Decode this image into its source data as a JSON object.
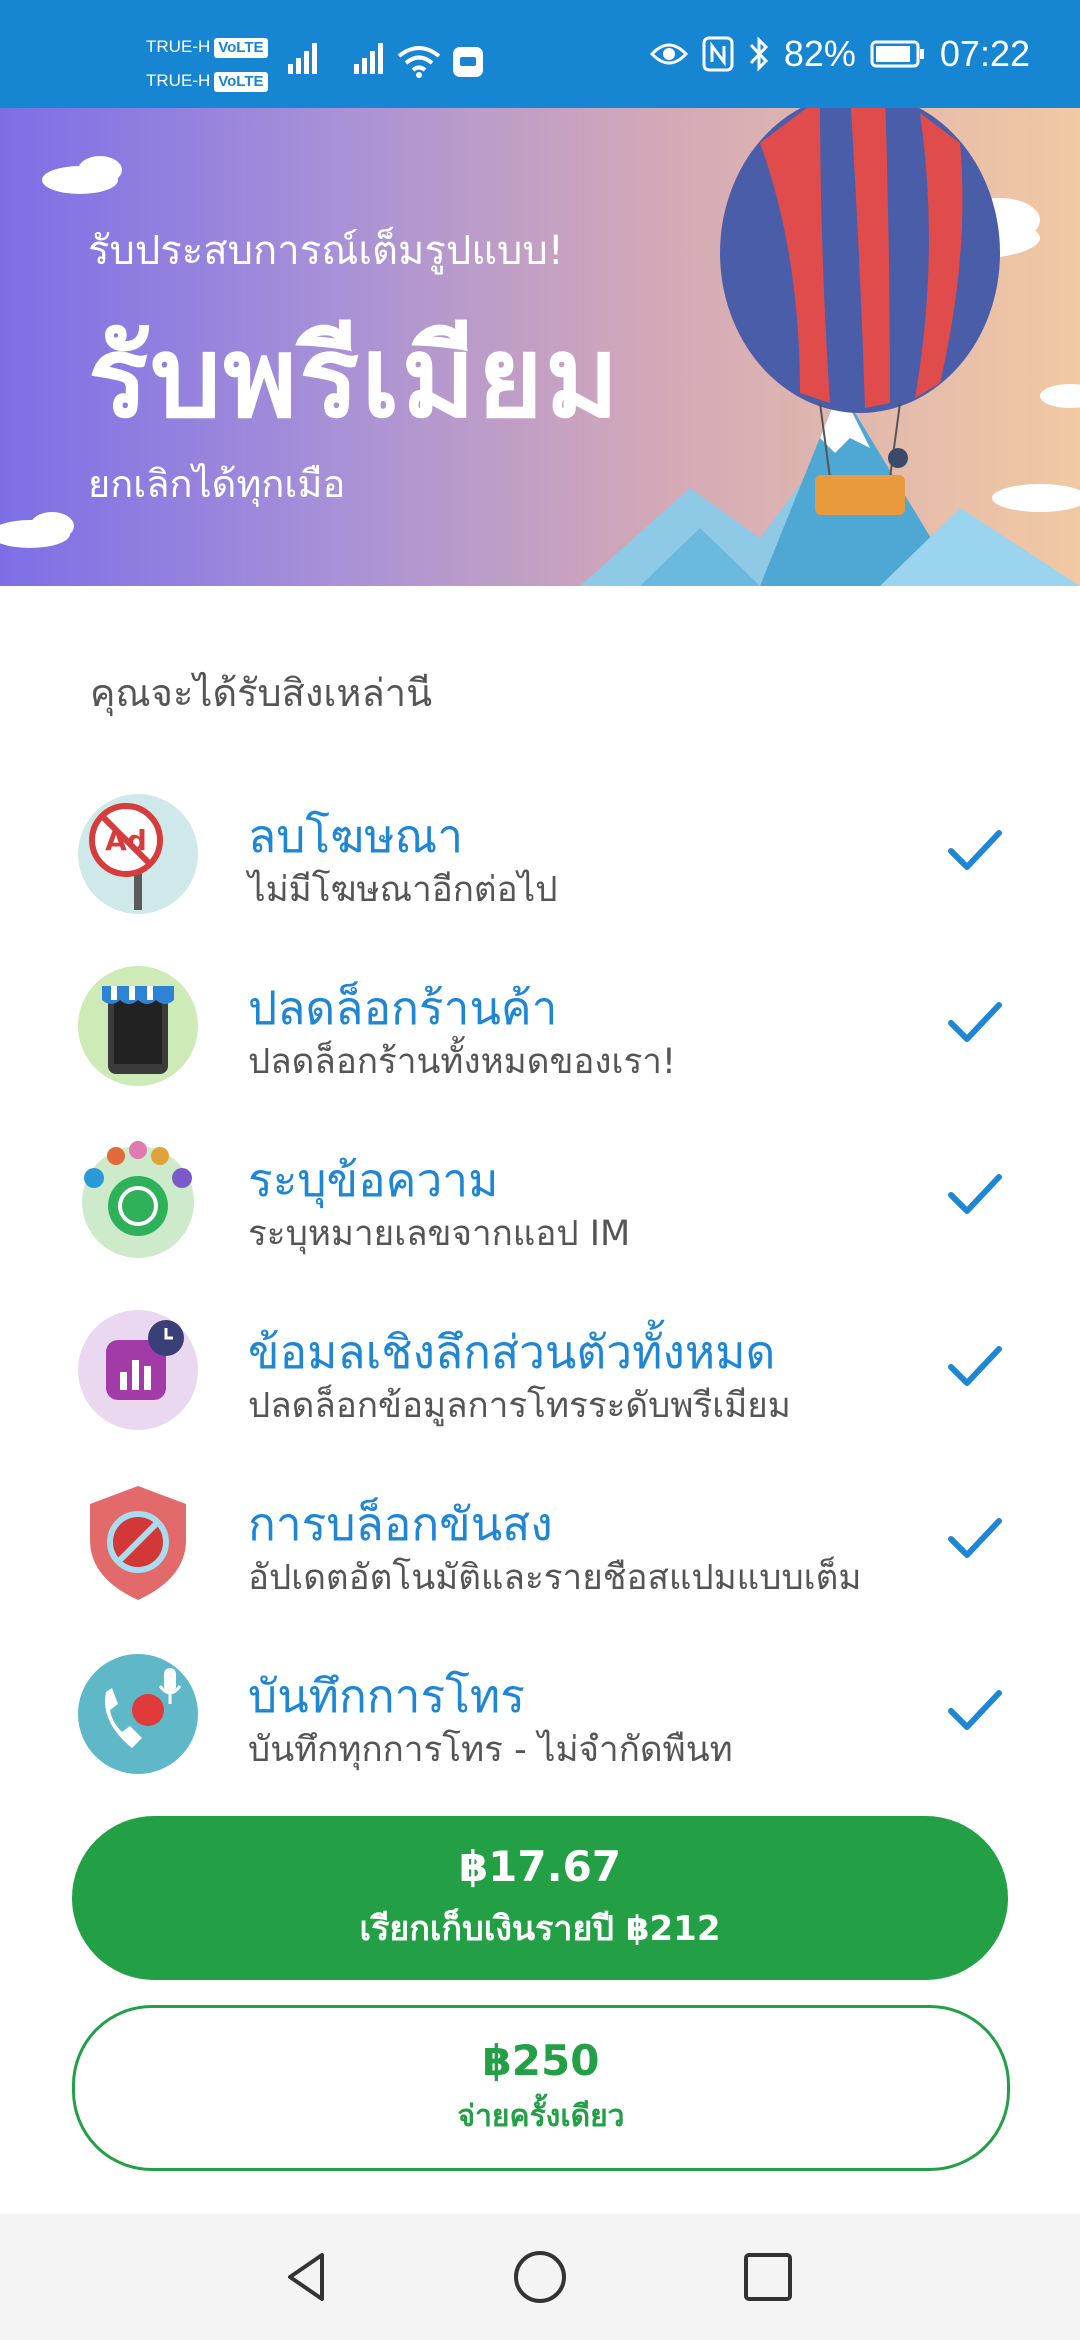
{
  "status_bar": {
    "carrier_1": "TRUE-H",
    "carrier_2": "TRUE-H",
    "volte": "VoLTE",
    "battery": "82%",
    "time": "07:22"
  },
  "banner": {
    "subtitle": "รับประสบการณ์เต็มรูปแบบ!",
    "title": "รับพรีเมียม",
    "cancel_note": "ยกเลิกได้ทุกเมือ"
  },
  "benefits_heading": "คุณจะได้รับสิงเหล่านี",
  "features": [
    {
      "title": "ลบโฆษณา",
      "desc": "ไม่มีโฆษณาอีกต่อไป",
      "icon": "no-ads-icon"
    },
    {
      "title": "ปลดล็อกร้านค้า",
      "desc": "ปลดล็อกร้านทั้งหมดของเรา!",
      "icon": "store-icon"
    },
    {
      "title": "ระบุข้อความ",
      "desc": "ระบุหมายเลขจากแอป IM",
      "icon": "messaging-apps-icon"
    },
    {
      "title": "ข้อมลเชิงลึกส่วนตัวทั้งหมด",
      "desc": "ปลดล็อกข้อมูลการโทรระดับพรีเมียม",
      "icon": "insights-icon"
    },
    {
      "title": "การบล็อกขันสง",
      "desc": "อัปเดตอัตโนมัติและรายชือสแปมแบบเต็ม",
      "icon": "shield-block-icon"
    },
    {
      "title": "บันทึกการโทร",
      "desc": "บันทึกทุกการโทร - ไม่จำกัดพืนท",
      "icon": "call-record-icon"
    }
  ],
  "plans": {
    "yearly_price": "฿17.67",
    "yearly_billing": "เรียกเก็บเงินรายปี ฿212",
    "once_price": "฿250",
    "once_note": "จ่ายครั้งเดียว"
  },
  "colors": {
    "accent_blue": "#1e86d4",
    "status_bar": "#1685d2",
    "primary_green": "#23a045"
  }
}
